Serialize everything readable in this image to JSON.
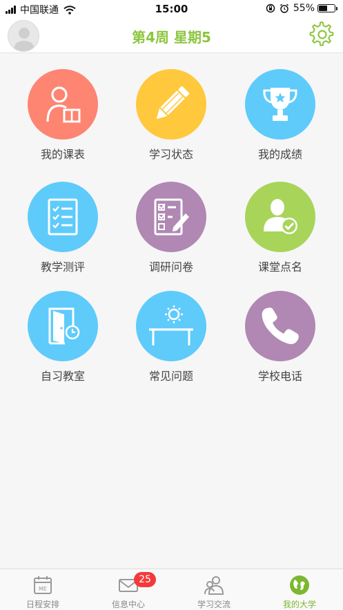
{
  "status_bar": {
    "carrier": "中国联通",
    "time": "15:00",
    "battery": "55%",
    "battery_level": 0.55,
    "icons": [
      "signal-icon",
      "wifi-icon",
      "orientation-lock-icon",
      "alarm-icon",
      "battery-icon"
    ]
  },
  "header": {
    "title": "第4周 星期5",
    "avatar_icon": "user-avatar-icon",
    "settings_icon": "gear-icon",
    "accent_color": "#8cc63f"
  },
  "tiles": [
    {
      "label": "我的课表",
      "icon": "person-book-icon",
      "color": "#fd8571"
    },
    {
      "label": "学习状态",
      "icon": "pencil-icon",
      "color": "#ffc83d"
    },
    {
      "label": "我的成绩",
      "icon": "trophy-icon",
      "color": "#5ecbfb"
    },
    {
      "label": "教学测评",
      "icon": "checklist-icon",
      "color": "#5ecbfb"
    },
    {
      "label": "调研问卷",
      "icon": "survey-edit-icon",
      "color": "#b088b3"
    },
    {
      "label": "课堂点名",
      "icon": "user-check-icon",
      "color": "#a8d45a"
    },
    {
      "label": "自习教室",
      "icon": "door-icon",
      "color": "#5ecbfb"
    },
    {
      "label": "常见问题",
      "icon": "sun-table-icon",
      "color": "#5ecbfb"
    },
    {
      "label": "学校电话",
      "icon": "phone-icon",
      "color": "#b088b3"
    }
  ],
  "tabbar": {
    "tabs": [
      {
        "label": "日程安排",
        "icon": "calendar-icon",
        "active": false,
        "calendar_text": "ME"
      },
      {
        "label": "信息中心",
        "icon": "mail-icon",
        "active": false,
        "badge": "25"
      },
      {
        "label": "学习交流",
        "icon": "people-icon",
        "active": false
      },
      {
        "label": "我的大学",
        "icon": "globe-icon",
        "active": true
      }
    ],
    "active_color": "#7cb82f",
    "badge_color": "#f23a3a"
  }
}
